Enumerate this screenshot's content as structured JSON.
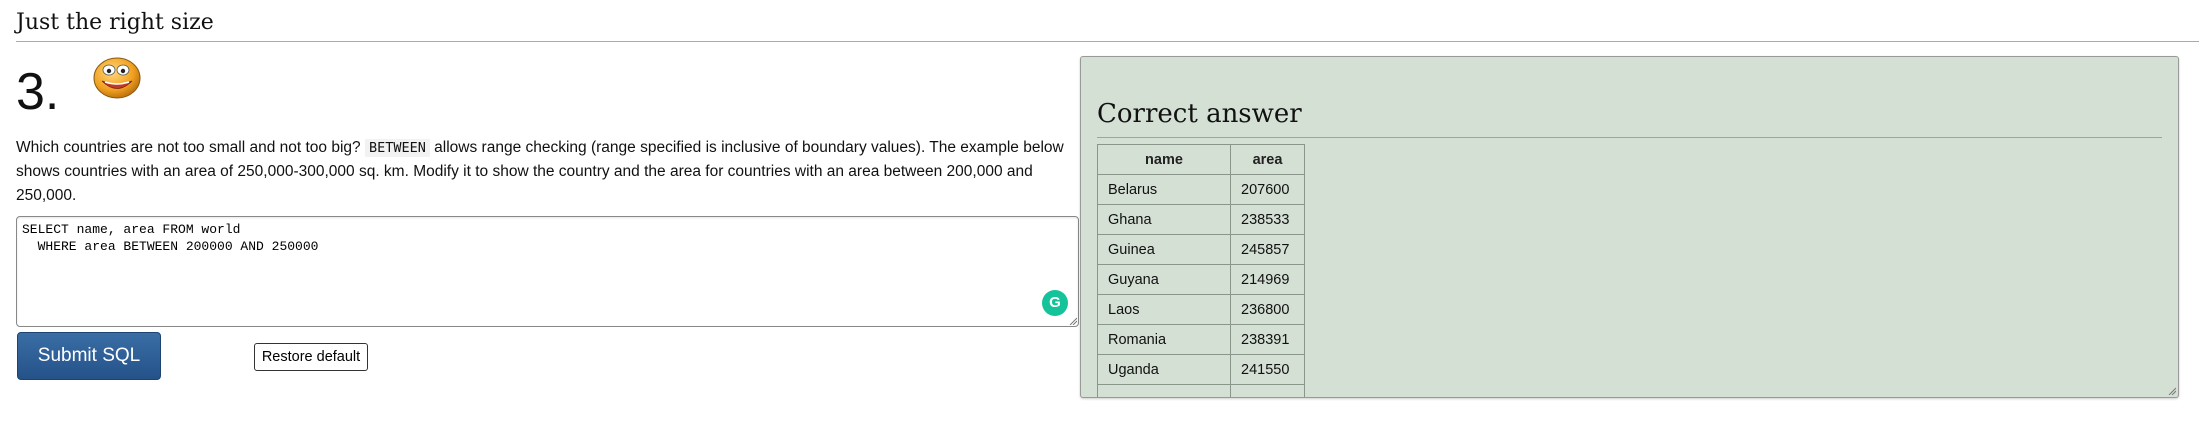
{
  "section": {
    "title": "Just the right size"
  },
  "question": {
    "number": "3.",
    "text_before": "Which countries are not too small and not too big?",
    "keyword": "BETWEEN",
    "text_after": "allows range checking (range specified is inclusive of boundary values). The example below shows countries with an area of 250,000-300,000 sq. km. Modify it to show the country and the area for countries with an area between 200,000 and 250,000."
  },
  "editor": {
    "sql": "SELECT name, area FROM world\n  WHERE area BETWEEN 200000 AND 250000",
    "grammarly_glyph": "G"
  },
  "buttons": {
    "submit_label": "Submit SQL",
    "restore_label": "Restore default"
  },
  "answer": {
    "title": "Correct answer",
    "columns": [
      "name",
      "area"
    ],
    "rows": [
      [
        "Belarus",
        "207600"
      ],
      [
        "Ghana",
        "238533"
      ],
      [
        "Guinea",
        "245857"
      ],
      [
        "Guyana",
        "214969"
      ],
      [
        "Laos",
        "236800"
      ],
      [
        "Romania",
        "238391"
      ],
      [
        "Uganda",
        "241550"
      ],
      [
        "",
        ""
      ]
    ]
  },
  "colors": {
    "panel_bg": "#d5e0d5",
    "submit_bg": "#2e5f96",
    "grammarly": "#15c39a",
    "smiley": "#f0a020"
  },
  "icons": [
    "smiley-icon",
    "grammarly-icon",
    "resize-grip-icon"
  ]
}
